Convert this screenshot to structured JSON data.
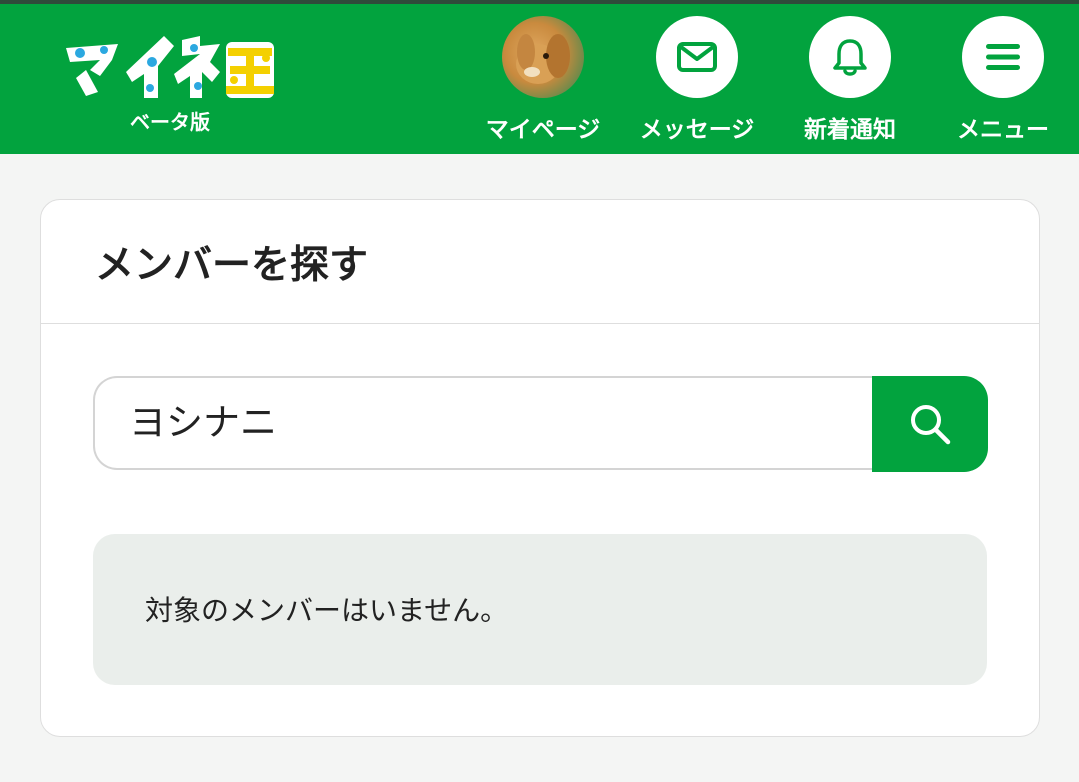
{
  "header": {
    "logo_text": "マイネ王",
    "logo_sub": "ベータ版",
    "nav": [
      {
        "label": "マイページ",
        "icon": "avatar"
      },
      {
        "label": "メッセージ",
        "icon": "envelope-icon"
      },
      {
        "label": "新着通知",
        "icon": "bell-icon"
      },
      {
        "label": "メニュー",
        "icon": "hamburger-menu-icon"
      }
    ]
  },
  "main": {
    "title": "メンバーを探す",
    "search": {
      "value": "ヨシナニ",
      "button_icon": "search-icon"
    },
    "notice": "対象のメンバーはいません。"
  },
  "colors": {
    "brand_green": "#02a33e",
    "notice_bg": "#eaeeeb"
  }
}
